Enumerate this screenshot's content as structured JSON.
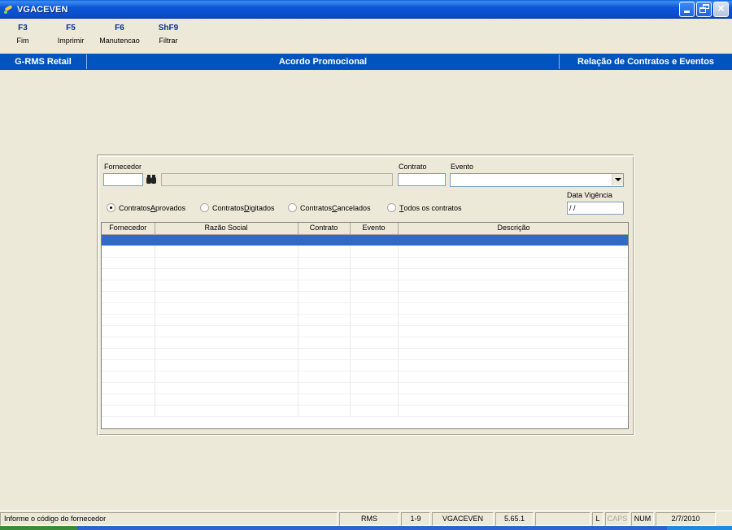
{
  "window": {
    "title": "VGACEVEN"
  },
  "fkeys": [
    {
      "key": "F3",
      "label": "Fim"
    },
    {
      "key": "F5",
      "label": "Imprimir"
    },
    {
      "key": "F6",
      "label": "Manutencao"
    },
    {
      "key": "ShF9",
      "label": "Filtrar"
    }
  ],
  "band": {
    "left": "G-RMS Retail",
    "center": "Acordo Promocional",
    "right": "Relação de Contratos e Eventos"
  },
  "form": {
    "fornecedor_label": "Fornecedor",
    "fornecedor_value": "",
    "razao_value": "",
    "contrato_label": "Contrato",
    "contrato_value": "",
    "evento_label": "Evento",
    "evento_value": "",
    "data_vigencia_label": "Data Vigência",
    "data_vigencia_value": " / /",
    "radios": [
      {
        "label_pre": "Contratos ",
        "hot": "A",
        "label_post": "provados",
        "selected": true
      },
      {
        "label_pre": "Contratos ",
        "hot": "D",
        "label_post": "igitados",
        "selected": false
      },
      {
        "label_pre": "Contratos ",
        "hot": "C",
        "label_post": "ancelados",
        "selected": false
      },
      {
        "label_pre": "",
        "hot": "T",
        "label_post": "odos os contratos",
        "selected": false
      }
    ]
  },
  "grid": {
    "columns": [
      "Fornecedor",
      "Razão Social",
      "Contrato",
      "Evento",
      "Descrição"
    ],
    "rows": []
  },
  "status": {
    "message": "Informe o código do fornecedor",
    "system": "RMS",
    "range": "1-9",
    "program": "VGACEVEN",
    "version": "5.65.1",
    "blank": "",
    "l": "L",
    "caps": "CAPS",
    "num": "NUM",
    "date": "2/7/2010"
  },
  "colors": {
    "band": "#0154BE",
    "titlebar": "#0B56D8",
    "selection": "#316AC5",
    "background": "#ECE9D8"
  }
}
